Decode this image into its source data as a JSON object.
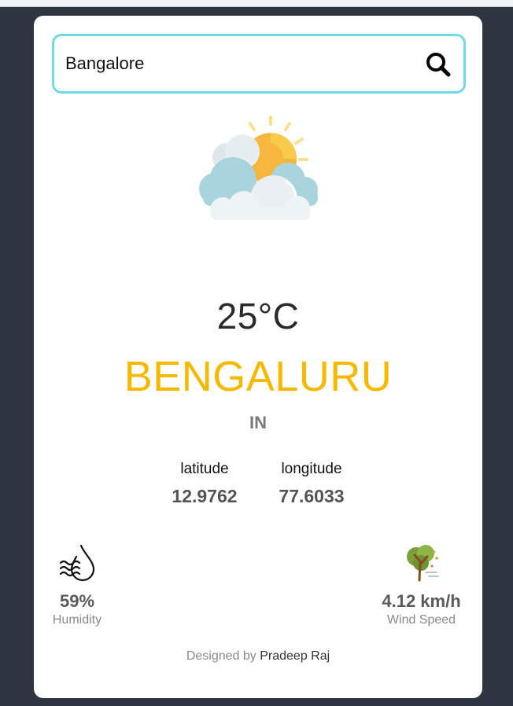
{
  "search": {
    "value": "Bangalore",
    "icon": "search-icon"
  },
  "weather": {
    "icon": "partly-cloudy-icon",
    "temperature": "25°C",
    "city": "BENGALURU",
    "country": "IN"
  },
  "coordinates": {
    "latitude_label": "latitude",
    "latitude_value": "12.9762",
    "longitude_label": "longitude",
    "longitude_value": "77.6033"
  },
  "stats": {
    "humidity_value": "59%",
    "humidity_label": "Humidity",
    "humidity_icon": "humidity-drop-icon",
    "wind_value": "4.12 km/h",
    "wind_label": "Wind Speed",
    "wind_icon": "windy-tree-icon"
  },
  "footer": {
    "prefix": "Designed by",
    "author": "Pradeep Raj"
  },
  "colors": {
    "accent": "#f7b900",
    "border": "#6fdbe6",
    "background": "#2f3540"
  }
}
